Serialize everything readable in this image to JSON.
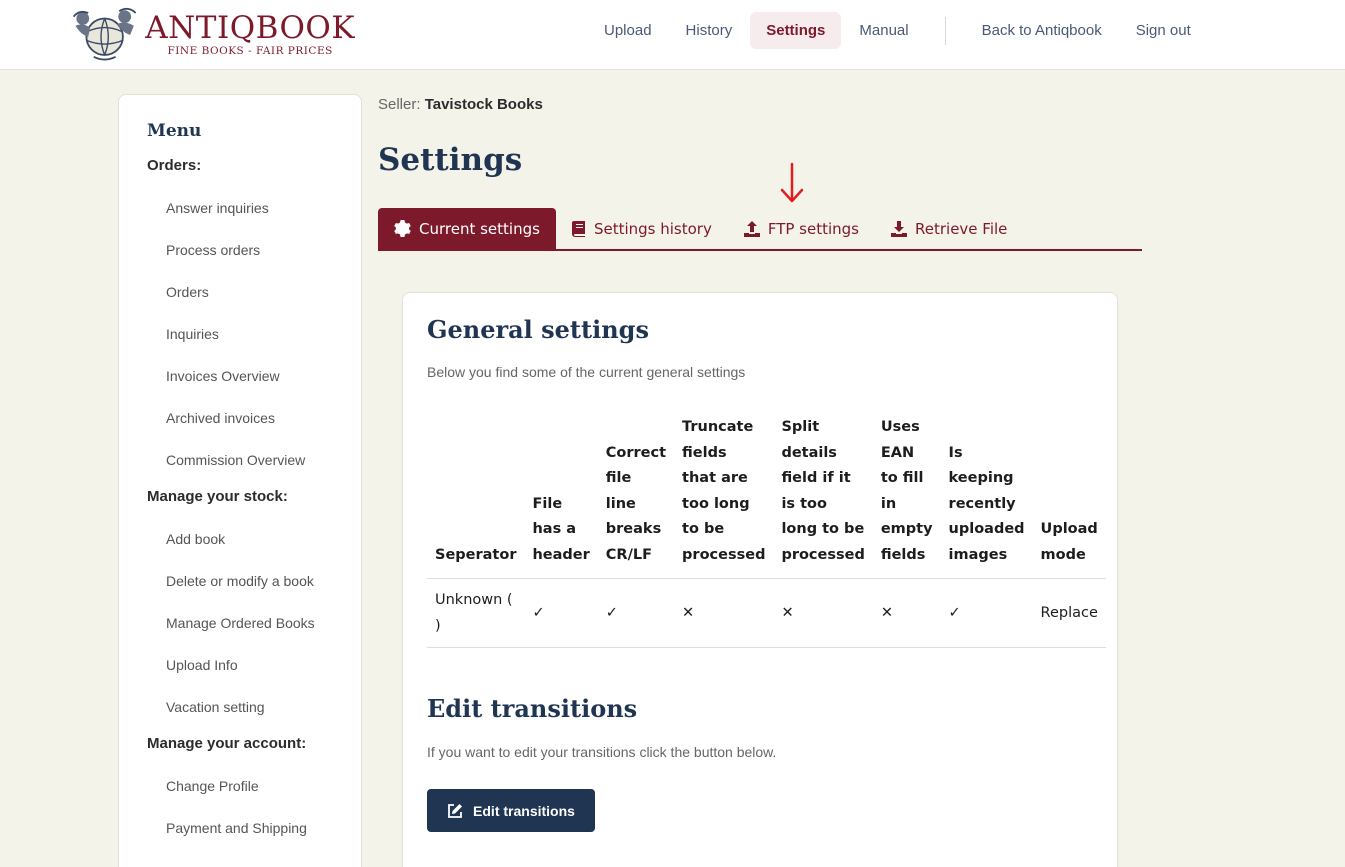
{
  "header": {
    "logo_name": "ANTIQBOOK",
    "logo_tagline": "FINE BOOKS - FAIR PRICES",
    "nav": [
      "Upload",
      "History",
      "Settings",
      "Manual"
    ],
    "nav_right": [
      "Back to Antiqbook",
      "Sign out"
    ],
    "active_nav": "Settings"
  },
  "sidebar": {
    "title": "Menu",
    "groups": [
      {
        "title": "Orders:",
        "items": [
          "Answer inquiries",
          "Process orders",
          "Orders",
          "Inquiries",
          "Invoices Overview",
          "Archived invoices",
          "Commission Overview"
        ]
      },
      {
        "title": "Manage your stock:",
        "items": [
          "Add book",
          "Delete or modify a book",
          "Manage Ordered Books",
          "Upload Info",
          "Vacation setting"
        ]
      },
      {
        "title": "Manage your account:",
        "items": [
          "Change Profile",
          "Payment and Shipping"
        ]
      }
    ]
  },
  "main": {
    "seller_label": "Seller:",
    "seller_name": "Tavistock Books",
    "title": "Settings",
    "tabs": [
      {
        "label": "Current settings",
        "icon": "gear-icon"
      },
      {
        "label": "Settings history",
        "icon": "book-icon"
      },
      {
        "label": "FTP settings",
        "icon": "upload-icon"
      },
      {
        "label": "Retrieve File",
        "icon": "download-icon"
      }
    ]
  },
  "general": {
    "title": "General settings",
    "description": "Below you find some of the current general settings",
    "columns": [
      "Seperator",
      "File has a header",
      "Correct file line breaks CR/LF",
      "Truncate fields that are too long to be processed",
      "Split details field if it is too long to be processed",
      "Uses EAN to fill in empty fields",
      "Is keeping recently uploaded images",
      "Upload mode"
    ],
    "row": {
      "separator": "Unknown ( )",
      "header": "✓",
      "crlf": "✓",
      "truncate": "✕",
      "split": "✕",
      "ean": "✕",
      "keep_images": "✓",
      "upload_mode": "Replace"
    }
  },
  "transitions": {
    "title": "Edit transitions",
    "description": "If you want to edit your transitions click the button below.",
    "button": "Edit transitions"
  },
  "colors": {
    "brand": "#7c1a2b",
    "navy": "#1f3552",
    "check": "#2e8b57",
    "cross": "#d93a3a",
    "background": "#f4f3ea"
  }
}
